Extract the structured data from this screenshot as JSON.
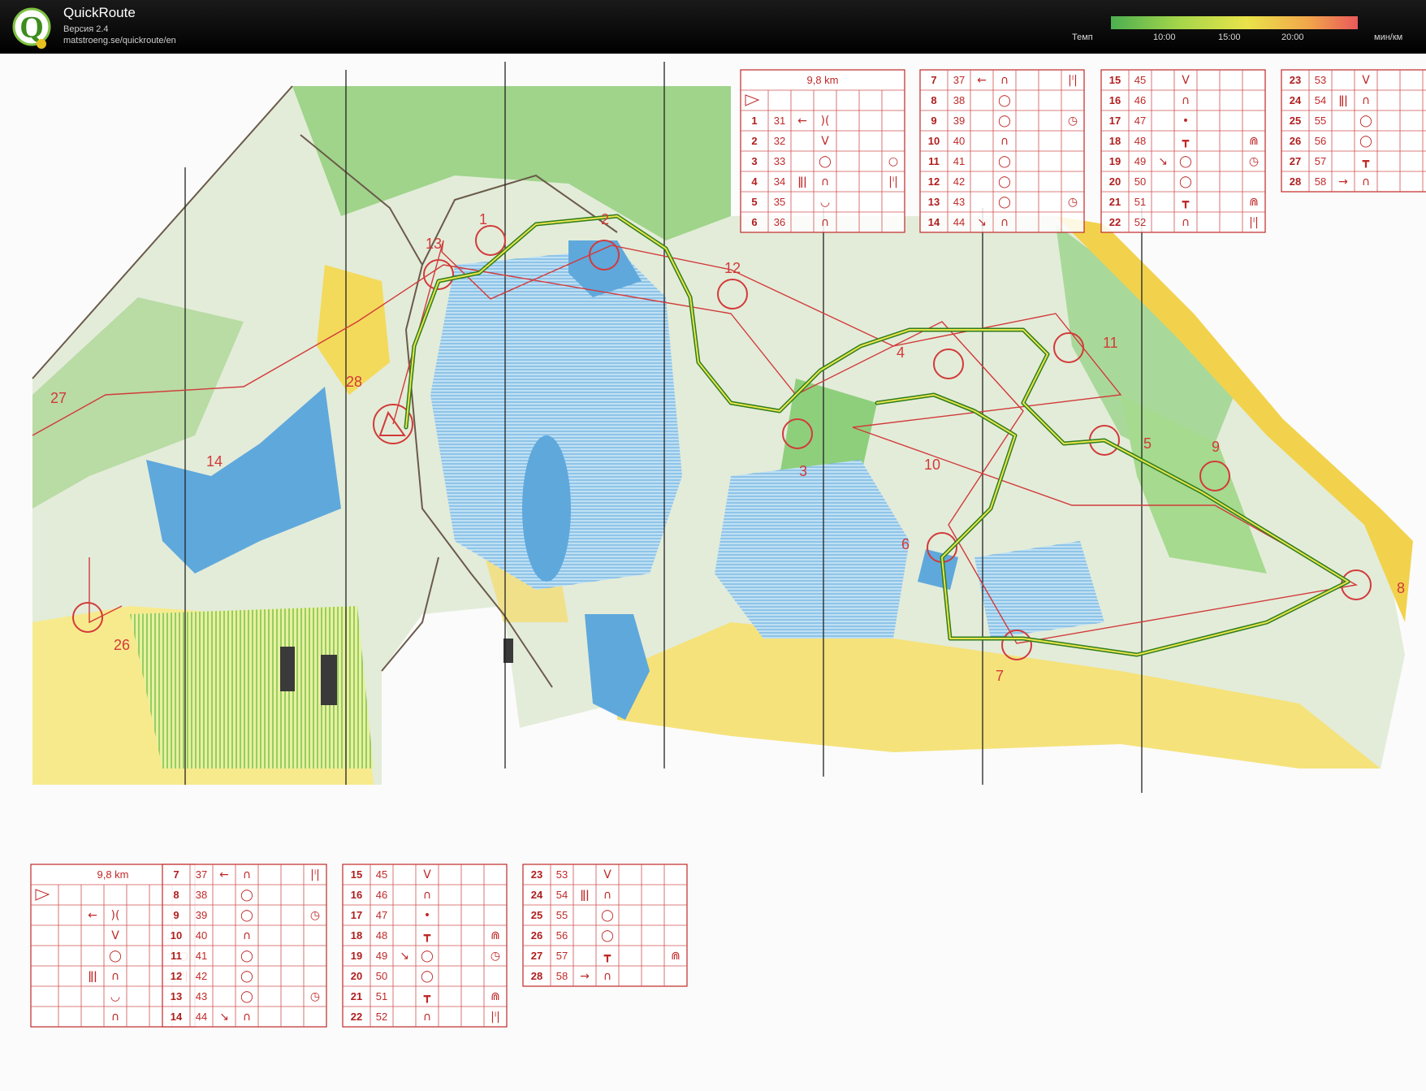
{
  "header": {
    "app_name": "QuickRoute",
    "version": "Версия 2.4",
    "url": "matstroeng.se/quickroute/en",
    "logo_letter": "Q"
  },
  "pace_legend": {
    "label": "Темп",
    "ticks": [
      "10:00",
      "15:00",
      "20:00"
    ],
    "unit": "мин/км",
    "colors": [
      "#4caf50",
      "#a6d64a",
      "#e9e34a",
      "#f2a64b",
      "#e9595b"
    ]
  },
  "map": {
    "control_numbers": [
      "1",
      "2",
      "3",
      "4",
      "5",
      "6",
      "7",
      "8",
      "9",
      "10",
      "11",
      "12",
      "13",
      "14",
      "26",
      "27",
      "28"
    ],
    "route_color": "#2f7d1f",
    "course_color": "#d23a3a",
    "colors": {
      "forest": "#bfe3a3",
      "forest_dark": "#6cc06a",
      "open": "#f4e06b",
      "water": "#5fa8dc",
      "marsh": "#8fc3e6",
      "paper": "#ffffff",
      "rock": "#c9d4c9"
    }
  },
  "descriptions": {
    "distance": "9,8 km",
    "top_blocks": [
      {
        "header": "9,8 km",
        "rows": [
          {
            "n": "1",
            "c": "31",
            "s1": "←",
            "s2": ")(",
            "s3": ""
          },
          {
            "n": "2",
            "c": "32",
            "s1": "",
            "s2": "V",
            "s3": ""
          },
          {
            "n": "3",
            "c": "33",
            "s1": "",
            "s2": "◯",
            "s3": "○"
          },
          {
            "n": "4",
            "c": "34",
            "s1": "ǁǀ",
            "s2": "∩",
            "s3": "|ˡ|"
          },
          {
            "n": "5",
            "c": "35",
            "s1": "",
            "s2": "◡",
            "s3": ""
          },
          {
            "n": "6",
            "c": "36",
            "s1": "",
            "s2": "∩",
            "s3": ""
          }
        ]
      },
      {
        "header": "",
        "rows": [
          {
            "n": "7",
            "c": "37",
            "s1": "←",
            "s2": "∩",
            "s3": "|ˡ|"
          },
          {
            "n": "8",
            "c": "38",
            "s1": "",
            "s2": "◯",
            "s3": ""
          },
          {
            "n": "9",
            "c": "39",
            "s1": "",
            "s2": "◯",
            "s3": "◷"
          },
          {
            "n": "10",
            "c": "40",
            "s1": "",
            "s2": "∩",
            "s3": ""
          },
          {
            "n": "11",
            "c": "41",
            "s1": "",
            "s2": "◯",
            "s3": ""
          },
          {
            "n": "12",
            "c": "42",
            "s1": "",
            "s2": "◯",
            "s3": ""
          },
          {
            "n": "13",
            "c": "43",
            "s1": "",
            "s2": "◯",
            "s3": "◷"
          },
          {
            "n": "14",
            "c": "44",
            "s1": "↘",
            "s2": "∩",
            "s3": ""
          }
        ]
      },
      {
        "header": "",
        "rows": [
          {
            "n": "15",
            "c": "45",
            "s1": "",
            "s2": "V",
            "s3": ""
          },
          {
            "n": "16",
            "c": "46",
            "s1": "",
            "s2": "∩",
            "s3": ""
          },
          {
            "n": "17",
            "c": "47",
            "s1": "",
            "s2": "•",
            "s3": ""
          },
          {
            "n": "18",
            "c": "48",
            "s1": "",
            "s2": "┳",
            "s3": "⋒"
          },
          {
            "n": "19",
            "c": "49",
            "s1": "↘",
            "s2": "◯",
            "s3": "◷"
          },
          {
            "n": "20",
            "c": "50",
            "s1": "",
            "s2": "◯",
            "s3": ""
          },
          {
            "n": "21",
            "c": "51",
            "s1": "",
            "s2": "┳",
            "s3": "⋒"
          },
          {
            "n": "22",
            "c": "52",
            "s1": "",
            "s2": "∩",
            "s3": "|ˡ|"
          }
        ]
      },
      {
        "header": "",
        "rows": [
          {
            "n": "23",
            "c": "53",
            "s1": "",
            "s2": "V",
            "s3": ""
          },
          {
            "n": "24",
            "c": "54",
            "s1": "ǁǀ",
            "s2": "∩",
            "s3": ""
          },
          {
            "n": "25",
            "c": "55",
            "s1": "",
            "s2": "◯",
            "s3": ""
          },
          {
            "n": "26",
            "c": "56",
            "s1": "",
            "s2": "◯",
            "s3": ""
          },
          {
            "n": "27",
            "c": "57",
            "s1": "",
            "s2": "┳",
            "s3": ""
          },
          {
            "n": "28",
            "c": "58",
            "s1": "→",
            "s2": "∩",
            "s3": ""
          }
        ]
      }
    ],
    "bottom_blocks": [
      {
        "header": "9,8 km",
        "rows": [
          {
            "n": "",
            "c": "",
            "s1": "←",
            "s2": ")(",
            "s3": ""
          },
          {
            "n": "",
            "c": "",
            "s1": "",
            "s2": "V",
            "s3": ""
          },
          {
            "n": "",
            "c": "",
            "s1": "",
            "s2": "◯",
            "s3": "○"
          },
          {
            "n": "",
            "c": "",
            "s1": "ǁǀ",
            "s2": "∩",
            "s3": "|ˡ|"
          },
          {
            "n": "",
            "c": "",
            "s1": "",
            "s2": "◡",
            "s3": ""
          },
          {
            "n": "",
            "c": "",
            "s1": "",
            "s2": "∩",
            "s3": ""
          }
        ]
      },
      {
        "header": "",
        "rows": [
          {
            "n": "7",
            "c": "37",
            "s1": "←",
            "s2": "∩",
            "s3": "|ˡ|"
          },
          {
            "n": "8",
            "c": "38",
            "s1": "",
            "s2": "◯",
            "s3": ""
          },
          {
            "n": "9",
            "c": "39",
            "s1": "",
            "s2": "◯",
            "s3": "◷"
          },
          {
            "n": "10",
            "c": "40",
            "s1": "",
            "s2": "∩",
            "s3": ""
          },
          {
            "n": "11",
            "c": "41",
            "s1": "",
            "s2": "◯",
            "s3": ""
          },
          {
            "n": "12",
            "c": "42",
            "s1": "",
            "s2": "◯",
            "s3": ""
          },
          {
            "n": "13",
            "c": "43",
            "s1": "",
            "s2": "◯",
            "s3": "◷"
          },
          {
            "n": "14",
            "c": "44",
            "s1": "↘",
            "s2": "∩",
            "s3": ""
          }
        ]
      },
      {
        "header": "",
        "rows": [
          {
            "n": "15",
            "c": "45",
            "s1": "",
            "s2": "V",
            "s3": ""
          },
          {
            "n": "16",
            "c": "46",
            "s1": "",
            "s2": "∩",
            "s3": ""
          },
          {
            "n": "17",
            "c": "47",
            "s1": "",
            "s2": "•",
            "s3": ""
          },
          {
            "n": "18",
            "c": "48",
            "s1": "",
            "s2": "┳",
            "s3": "⋒"
          },
          {
            "n": "19",
            "c": "49",
            "s1": "↘",
            "s2": "◯",
            "s3": "◷"
          },
          {
            "n": "20",
            "c": "50",
            "s1": "",
            "s2": "◯",
            "s3": ""
          },
          {
            "n": "21",
            "c": "51",
            "s1": "",
            "s2": "┳",
            "s3": "⋒"
          },
          {
            "n": "22",
            "c": "52",
            "s1": "",
            "s2": "∩",
            "s3": "|ˡ|"
          }
        ]
      },
      {
        "header": "",
        "rows": [
          {
            "n": "23",
            "c": "53",
            "s1": "",
            "s2": "V",
            "s3": ""
          },
          {
            "n": "24",
            "c": "54",
            "s1": "ǁǀ",
            "s2": "∩",
            "s3": ""
          },
          {
            "n": "25",
            "c": "55",
            "s1": "",
            "s2": "◯",
            "s3": ""
          },
          {
            "n": "26",
            "c": "56",
            "s1": "",
            "s2": "◯",
            "s3": ""
          },
          {
            "n": "27",
            "c": "57",
            "s1": "",
            "s2": "┳",
            "s3": "⋒"
          },
          {
            "n": "28",
            "c": "58",
            "s1": "→",
            "s2": "∩",
            "s3": ""
          }
        ]
      }
    ]
  }
}
